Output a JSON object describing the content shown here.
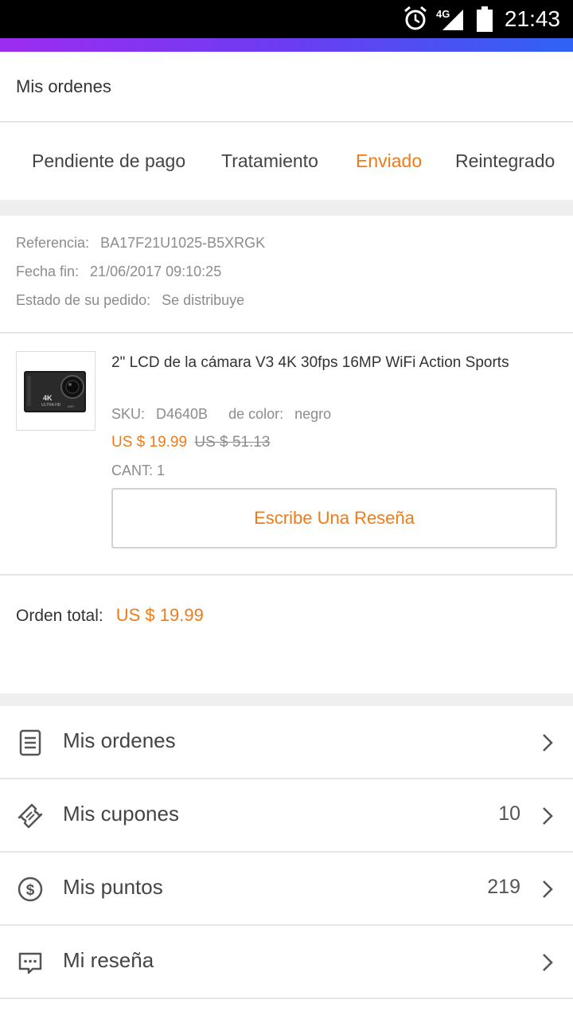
{
  "status_bar": {
    "time": "21:43",
    "network": "4G"
  },
  "header": {
    "title": "Mis ordenes"
  },
  "tabs": [
    {
      "label": "Pendiente de pago",
      "active": false
    },
    {
      "label": "Tratamiento",
      "active": false
    },
    {
      "label": "Enviado",
      "active": true
    },
    {
      "label": "Reintegrado",
      "active": false
    }
  ],
  "order": {
    "reference_label": "Referencia:",
    "reference": "BA17F21U1025-B5XRGK",
    "date_label": "Fecha fin:",
    "date": "21/06/2017 09:10:25",
    "status_label": "Estado de su pedido:",
    "status": "Se distribuye"
  },
  "product": {
    "name": "2\" LCD de la cámara V3 4K 30fps 16MP WiFi Action Sports",
    "sku_label": "SKU:",
    "sku": "D4640B",
    "color_label": "de color:",
    "color": "negro",
    "price": "US $ 19.99",
    "old_price": "US $ 51.13",
    "quantity": "CANT: 1",
    "review_button": "Escribe Una Reseña"
  },
  "total": {
    "label": "Orden total:",
    "amount": "US $ 19.99"
  },
  "menu": [
    {
      "label": "Mis ordenes",
      "icon": "document-icon",
      "count": ""
    },
    {
      "label": "Mis cupones",
      "icon": "coupon-icon",
      "count": "10"
    },
    {
      "label": "Mis puntos",
      "icon": "dollar-coin-icon",
      "count": "219"
    },
    {
      "label": "Mi reseña",
      "icon": "chat-bubble-icon",
      "count": ""
    }
  ],
  "colors": {
    "accent": "#f07b18",
    "gradient_start": "#9d2cf0",
    "gradient_end": "#2f63f5"
  }
}
